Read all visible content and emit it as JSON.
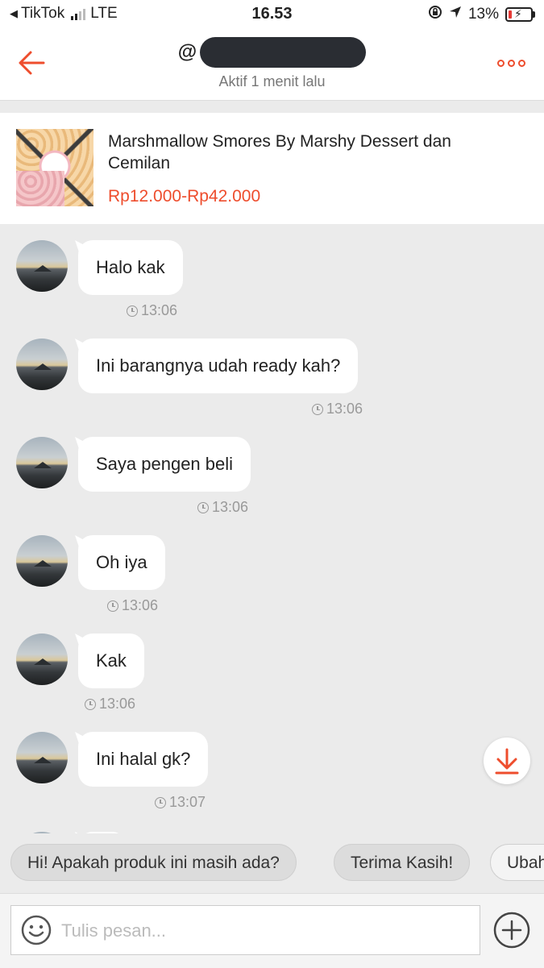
{
  "status_bar": {
    "back_app": "TikTok",
    "network": "LTE",
    "time": "16.53",
    "battery": "13%"
  },
  "header": {
    "username_prefix": "@",
    "active_status": "Aktif 1 menit lalu"
  },
  "product": {
    "title": "Marshmallow Smores By Marshy Dessert dan Cemilan",
    "price": "Rp12.000-Rp42.000"
  },
  "messages": [
    {
      "text": "Halo kak",
      "time": "13:06"
    },
    {
      "text": "Ini barangnya udah ready kah?",
      "time": "13:06"
    },
    {
      "text": "Saya pengen beli",
      "time": "13:06"
    },
    {
      "text": "Oh iya",
      "time": "13:06"
    },
    {
      "text": "Kak",
      "time": "13:06"
    },
    {
      "text": "Ini halal gk?",
      "time": "13:07"
    }
  ],
  "quick_replies": [
    "Hi! Apakah produk ini masih ada?",
    "Terima Kasih!",
    "Ubah"
  ],
  "input": {
    "placeholder": "Tulis pesan..."
  },
  "colors": {
    "accent": "#ee4d2d",
    "chat_background": "#ebebeb"
  },
  "icons": {
    "back": "arrow-left-icon",
    "more": "more-dots-icon",
    "scroll_down": "arrow-down-icon",
    "emoji": "smiley-icon",
    "plus": "plus-circle-icon",
    "clock": "clock-icon"
  }
}
